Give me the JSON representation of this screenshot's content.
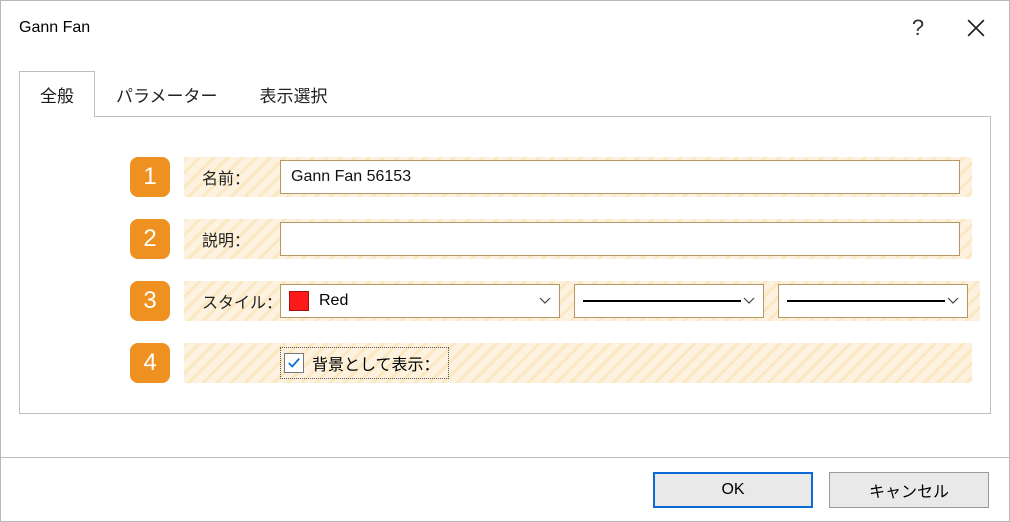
{
  "title": "Gann Fan",
  "tabs": {
    "general": "全般",
    "parameters": "パラメーター",
    "display": "表示選択"
  },
  "rows": {
    "r1": {
      "num": "1",
      "label": "名前：",
      "value": "Gann Fan 56153"
    },
    "r2": {
      "num": "2",
      "label": "説明：",
      "value": ""
    },
    "r3": {
      "num": "3",
      "label": "スタイル：",
      "color_name": "Red"
    },
    "r4": {
      "num": "4",
      "check_label": "背景として表示："
    }
  },
  "style": {
    "swatch_color": "#ff1a1a"
  },
  "footer": {
    "ok": "OK",
    "cancel": "キャンセル"
  },
  "icons": {
    "help": "?",
    "chev": "⌄"
  }
}
